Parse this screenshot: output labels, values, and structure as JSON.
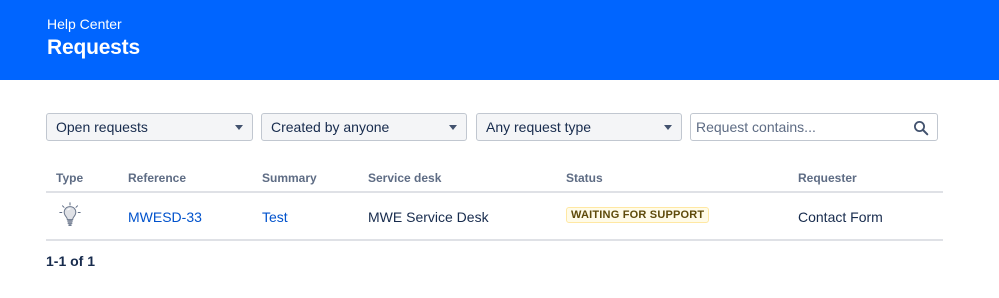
{
  "header": {
    "breadcrumb": "Help Center",
    "title": "Requests",
    "background": "#0065ff"
  },
  "filters": {
    "status": {
      "selected": "Open requests"
    },
    "creator": {
      "selected": "Created by anyone"
    },
    "request_type": {
      "selected": "Any request type"
    },
    "search": {
      "placeholder": "Request contains...",
      "value": "",
      "icon": "search-icon"
    }
  },
  "table": {
    "columns": [
      "Type",
      "Reference",
      "Summary",
      "Service desk",
      "Status",
      "Requester"
    ],
    "rows": [
      {
        "type_icon": "lightbulb-icon",
        "reference": "MWESD-33",
        "summary": "Test",
        "service_desk": "MWE Service Desk",
        "status": "WAITING FOR SUPPORT",
        "requester": "Contact Form"
      }
    ]
  },
  "pagination": {
    "text": "1-1 of 1"
  },
  "colors": {
    "link": "#0052cc",
    "text": "#172b4d",
    "status_bg": "#fffbe8",
    "status_border": "#ffe8a3"
  }
}
